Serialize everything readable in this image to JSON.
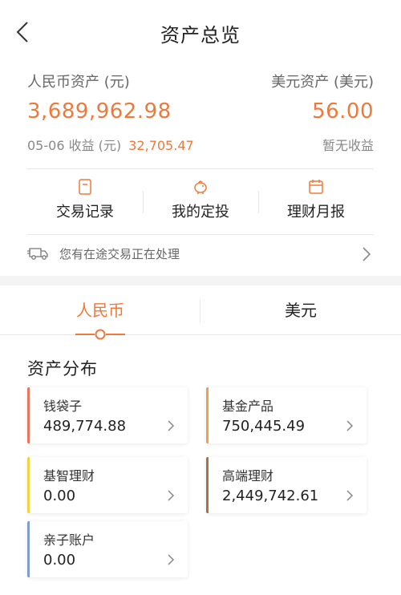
{
  "header": {
    "title": "资产总览"
  },
  "overview": {
    "rmb_label": "人民币资产 (元)",
    "rmb_amount": "3,689,962.98",
    "rmb_income_label": "05-06 收益 (元)",
    "rmb_income_value": "32,705.47",
    "usd_label": "美元资产 (美元)",
    "usd_amount": "56.00",
    "usd_income": "暂无收益"
  },
  "quick_actions": [
    {
      "label": "交易记录",
      "icon": "document-icon"
    },
    {
      "label": "我的定投",
      "icon": "piggy-bank-icon"
    },
    {
      "label": "理财月报",
      "icon": "calendar-icon"
    }
  ],
  "pending": {
    "text": "您有在途交易正在处理",
    "icon": "truck-icon"
  },
  "tabs": [
    {
      "label": "人民币",
      "active": true
    },
    {
      "label": "美元",
      "active": false
    }
  ],
  "distribution": {
    "title": "资产分布",
    "items": [
      {
        "name": "钱袋子",
        "value": "489,774.88",
        "color": "#e8765f"
      },
      {
        "name": "基金产品",
        "value": "750,445.49",
        "color": "#f0a048"
      },
      {
        "name": "基智理财",
        "value": "0.00",
        "color": "#f2d340"
      },
      {
        "name": "高端理财",
        "value": "2,449,742.61",
        "color": "#a8743a"
      },
      {
        "name": "亲子账户",
        "value": "0.00",
        "color": "#7f9fc8"
      }
    ]
  },
  "colors": {
    "accent": "#f0793a",
    "divider": "#e6e6e6",
    "band": "#f4f4f4"
  }
}
